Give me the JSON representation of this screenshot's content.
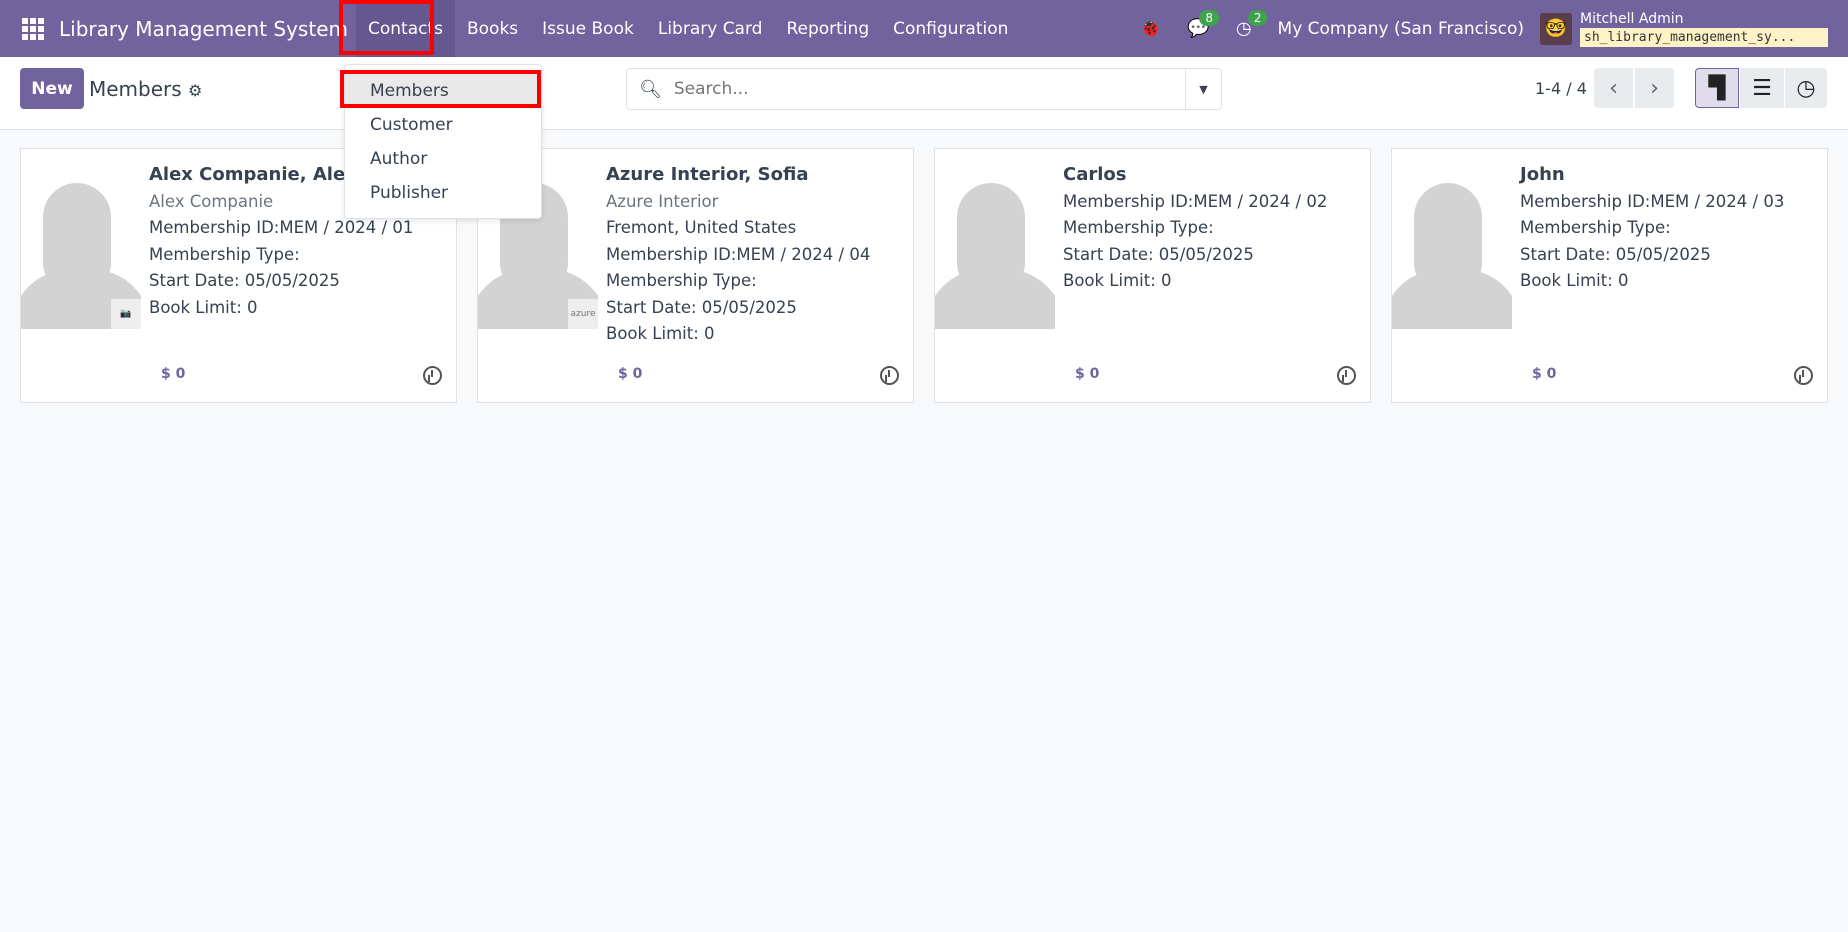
{
  "navbar": {
    "app_title": "Library Management System",
    "menus": [
      "Contacts",
      "Books",
      "Issue Book",
      "Library Card",
      "Reporting",
      "Configuration"
    ],
    "messages_count": "8",
    "activities_count": "2",
    "company": "My Company (San Francisco)",
    "user": "Mitchell Admin",
    "database": "sh_library_management_sy..."
  },
  "control": {
    "new_label": "New",
    "title": "Members",
    "search_placeholder": "Search...",
    "pager": "1-4 / 4"
  },
  "dropdown": {
    "items": [
      "Members",
      "Customer",
      "Author",
      "Publisher"
    ]
  },
  "cards": [
    {
      "name": "Alex Companie, Alex",
      "company": "Alex Companie",
      "lines": [
        "Membership ID:MEM / 2024 / 01",
        "Membership Type:",
        "Start Date: 05/05/2025",
        "Book Limit: 0"
      ],
      "amount": "$ 0",
      "badge": ""
    },
    {
      "name": "Azure Interior, Sofia",
      "company": "Azure Interior",
      "lines": [
        "Fremont, United States",
        "Membership ID:MEM / 2024 / 04",
        "Membership Type:",
        "Start Date: 05/05/2025",
        "Book Limit: 0"
      ],
      "amount": "$ 0",
      "badge": "azure"
    },
    {
      "name": "Carlos",
      "company": "",
      "lines": [
        "Membership ID:MEM / 2024 / 02",
        "Membership Type:",
        "Start Date: 05/05/2025",
        "Book Limit: 0"
      ],
      "amount": "$ 0"
    },
    {
      "name": "John",
      "company": "",
      "lines": [
        "Membership ID:MEM / 2024 / 03",
        "Membership Type:",
        "Start Date: 05/05/2025",
        "Book Limit: 0"
      ],
      "amount": "$ 0"
    }
  ]
}
